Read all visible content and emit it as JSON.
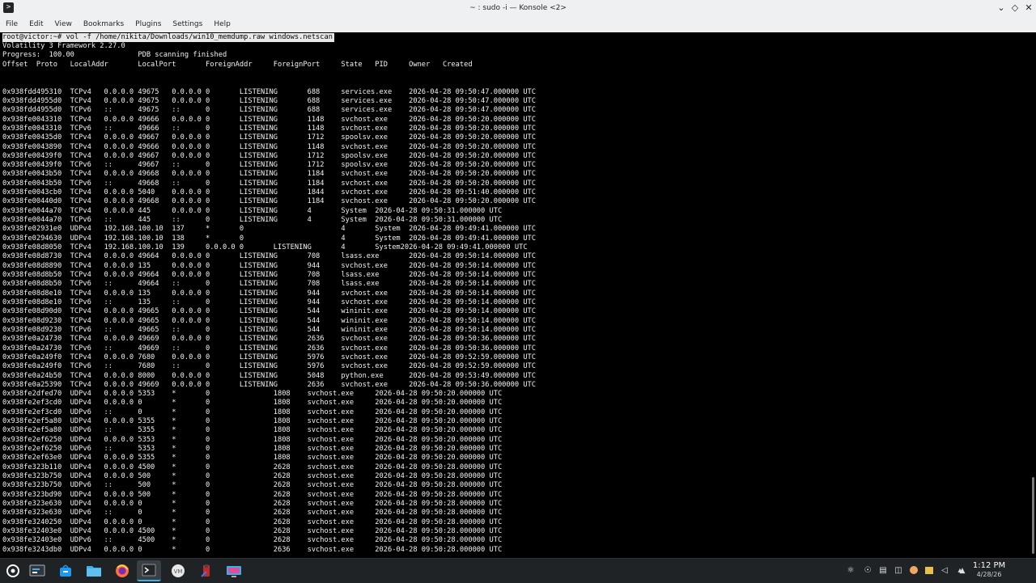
{
  "window": {
    "title": "~ : sudo -i — Konsole <2>"
  },
  "menu": [
    "File",
    "Edit",
    "View",
    "Bookmarks",
    "Plugins",
    "Settings",
    "Help"
  ],
  "terminal": {
    "prompt_line": "root@victor:~# vol -f /home/nikita/Downloads/win10_memdump.raw windows.netscan",
    "lines": [
      "Volatility 3 Framework 2.27.0",
      "Progress:  100.00               PDB scanning finished",
      "Offset  Proto   LocalAddr       LocalPort       ForeignAddr     ForeignPort     State   PID     Owner   Created",
      "",
      "",
      "0x938fdd495310  TCPv4   0.0.0.0 49675   0.0.0.0 0       LISTENING       688     services.exe    2026-04-28 09:50:47.000000 UTC",
      "0x938fdd4955d0  TCPv4   0.0.0.0 49675   0.0.0.0 0       LISTENING       688     services.exe    2026-04-28 09:50:47.000000 UTC",
      "0x938fdd4955d0  TCPv6   ::      49675   ::      0       LISTENING       688     services.exe    2026-04-28 09:50:47.000000 UTC",
      "0x938fe0043310  TCPv4   0.0.0.0 49666   0.0.0.0 0       LISTENING       1148    svchost.exe     2026-04-28 09:50:20.000000 UTC",
      "0x938fe0043310  TCPv6   ::      49666   ::      0       LISTENING       1148    svchost.exe     2026-04-28 09:50:20.000000 UTC",
      "0x938fe00435d0  TCPv4   0.0.0.0 49667   0.0.0.0 0       LISTENING       1712    spoolsv.exe     2026-04-28 09:50:20.000000 UTC",
      "0x938fe0043890  TCPv4   0.0.0.0 49666   0.0.0.0 0       LISTENING       1148    svchost.exe     2026-04-28 09:50:20.000000 UTC",
      "0x938fe00439f0  TCPv4   0.0.0.0 49667   0.0.0.0 0       LISTENING       1712    spoolsv.exe     2026-04-28 09:50:20.000000 UTC",
      "0x938fe00439f0  TCPv6   ::      49667   ::      0       LISTENING       1712    spoolsv.exe     2026-04-28 09:50:20.000000 UTC",
      "0x938fe0043b50  TCPv4   0.0.0.0 49668   0.0.0.0 0       LISTENING       1184    svchost.exe     2026-04-28 09:50:20.000000 UTC",
      "0x938fe0043b50  TCPv6   ::      49668   ::      0       LISTENING       1184    svchost.exe     2026-04-28 09:50:20.000000 UTC",
      "0x938fe0043cb0  TCPv4   0.0.0.0 5040    0.0.0.0 0       LISTENING       1844    svchost.exe     2026-04-28 09:51:40.000000 UTC",
      "0x938fe00440d0  TCPv4   0.0.0.0 49668   0.0.0.0 0       LISTENING       1184    svchost.exe     2026-04-28 09:50:20.000000 UTC",
      "0x938fe0044a70  TCPv4   0.0.0.0 445     0.0.0.0 0       LISTENING       4       System  2026-04-28 09:50:31.000000 UTC",
      "0x938fe0044a70  TCPv6   ::      445     ::      0       LISTENING       4       System  2026-04-28 09:50:31.000000 UTC",
      "0x938fe02931e0  UDPv4   192.168.100.10  137     *       0                       4       System  2026-04-28 09:49:41.000000 UTC",
      "0x938fe0294630  UDPv4   192.168.100.10  138     *       0                       4       System  2026-04-28 09:49:41.000000 UTC",
      "0x938fe08d8050  TCPv4   192.168.100.10  139     0.0.0.0 0       LISTENING       4       System2026-04-28 09:49:41.000000 UTC",
      "0x938fe08d8730  TCPv4   0.0.0.0 49664   0.0.0.0 0       LISTENING       708     lsass.exe       2026-04-28 09:50:14.000000 UTC",
      "0x938fe08d8890  TCPv4   0.0.0.0 135     0.0.0.0 0       LISTENING       944     svchost.exe     2026-04-28 09:50:14.000000 UTC",
      "0x938fe08d8b50  TCPv4   0.0.0.0 49664   0.0.0.0 0       LISTENING       708     lsass.exe       2026-04-28 09:50:14.000000 UTC",
      "0x938fe08d8b50  TCPv6   ::      49664   ::      0       LISTENING       708     lsass.exe       2026-04-28 09:50:14.000000 UTC",
      "0x938fe08d8e10  TCPv4   0.0.0.0 135     0.0.0.0 0       LISTENING       944     svchost.exe     2026-04-28 09:50:14.000000 UTC",
      "0x938fe08d8e10  TCPv6   ::      135     ::      0       LISTENING       944     svchost.exe     2026-04-28 09:50:14.000000 UTC",
      "0x938fe08d90d0  TCPv4   0.0.0.0 49665   0.0.0.0 0       LISTENING       544     wininit.exe     2026-04-28 09:50:14.000000 UTC",
      "0x938fe08d9230  TCPv4   0.0.0.0 49665   0.0.0.0 0       LISTENING       544     wininit.exe     2026-04-28 09:50:14.000000 UTC",
      "0x938fe08d9230  TCPv6   ::      49665   ::      0       LISTENING       544     wininit.exe     2026-04-28 09:50:14.000000 UTC",
      "0x938fe0a24730  TCPv4   0.0.0.0 49669   0.0.0.0 0       LISTENING       2636    svchost.exe     2026-04-28 09:50:36.000000 UTC",
      "0x938fe0a24730  TCPv6   ::      49669   ::      0       LISTENING       2636    svchost.exe     2026-04-28 09:50:36.000000 UTC",
      "0x938fe0a249f0  TCPv4   0.0.0.0 7680    0.0.0.0 0       LISTENING       5976    svchost.exe     2026-04-28 09:52:59.000000 UTC",
      "0x938fe0a249f0  TCPv6   ::      7680    ::      0       LISTENING       5976    svchost.exe     2026-04-28 09:52:59.000000 UTC",
      "0x938fe0a24b50  TCPv4   0.0.0.0 8000    0.0.0.0 0       LISTENING       5048    python.exe      2026-04-28 09:53:49.000000 UTC",
      "0x938fe0a25390  TCPv4   0.0.0.0 49669   0.0.0.0 0       LISTENING       2636    svchost.exe     2026-04-28 09:50:36.000000 UTC",
      "0x938fe2dfed70  UDPv4   0.0.0.0 5353    *       0               1808    svchost.exe     2026-04-28 09:50:20.000000 UTC",
      "0x938fe2ef3cd0  UDPv4   0.0.0.0 0       *       0               1808    svchost.exe     2026-04-28 09:50:20.000000 UTC",
      "0x938fe2ef3cd0  UDPv6   ::      0       *       0               1808    svchost.exe     2026-04-28 09:50:20.000000 UTC",
      "0x938fe2ef5a80  UDPv4   0.0.0.0 5355    *       0               1808    svchost.exe     2026-04-28 09:50:20.000000 UTC",
      "0x938fe2ef5a80  UDPv6   ::      5355    *       0               1808    svchost.exe     2026-04-28 09:50:20.000000 UTC",
      "0x938fe2ef6250  UDPv4   0.0.0.0 5353    *       0               1808    svchost.exe     2026-04-28 09:50:20.000000 UTC",
      "0x938fe2ef6250  UDPv6   ::      5353    *       0               1808    svchost.exe     2026-04-28 09:50:20.000000 UTC",
      "0x938fe2ef63e0  UDPv4   0.0.0.0 5355    *       0               1808    svchost.exe     2026-04-28 09:50:20.000000 UTC",
      "0x938fe323b110  UDPv4   0.0.0.0 4500    *       0               2628    svchost.exe     2026-04-28 09:50:28.000000 UTC",
      "0x938fe323b750  UDPv4   0.0.0.0 500     *       0               2628    svchost.exe     2026-04-28 09:50:28.000000 UTC",
      "0x938fe323b750  UDPv6   ::      500     *       0               2628    svchost.exe     2026-04-28 09:50:28.000000 UTC",
      "0x938fe323bd90  UDPv4   0.0.0.0 500     *       0               2628    svchost.exe     2026-04-28 09:50:28.000000 UTC",
      "0x938fe323e630  UDPv4   0.0.0.0 0       *       0               2628    svchost.exe     2026-04-28 09:50:28.000000 UTC",
      "0x938fe323e630  UDPv6   ::      0       *       0               2628    svchost.exe     2026-04-28 09:50:28.000000 UTC",
      "0x938fe3240250  UDPv4   0.0.0.0 0       *       0               2628    svchost.exe     2026-04-28 09:50:28.000000 UTC",
      "0x938fe32403e0  UDPv4   0.0.0.0 4500    *       0               2628    svchost.exe     2026-04-28 09:50:28.000000 UTC",
      "0x938fe32403e0  UDPv6   ::      4500    *       0               2628    svchost.exe     2026-04-28 09:50:28.000000 UTC",
      "0x938fe3243db0  UDPv4   0.0.0.0 0       *       0               2636    svchost.exe     2026-04-28 09:50:28.000000 UTC"
    ]
  },
  "taskbar": {
    "apps": [
      {
        "icon": "app-launcher-icon"
      },
      {
        "icon": "system-settings-icon"
      },
      {
        "icon": "discover-store-icon"
      },
      {
        "icon": "file-manager-icon"
      },
      {
        "icon": "firefox-icon"
      },
      {
        "icon": "konsole-icon"
      },
      {
        "icon": "vmware-icon"
      },
      {
        "icon": "burp-icon"
      },
      {
        "icon": "remote-desktop-icon"
      }
    ],
    "tray": [
      "network-icon",
      "vpn-icon",
      "clipboard-icon",
      "storage-icon",
      "updates-icon",
      "notes-icon",
      "volume-icon",
      "wifi-icon",
      "bluetooth-icon",
      "expand-tray-icon"
    ],
    "clock_time": "1:12 PM",
    "clock_date": "4/28/26"
  }
}
